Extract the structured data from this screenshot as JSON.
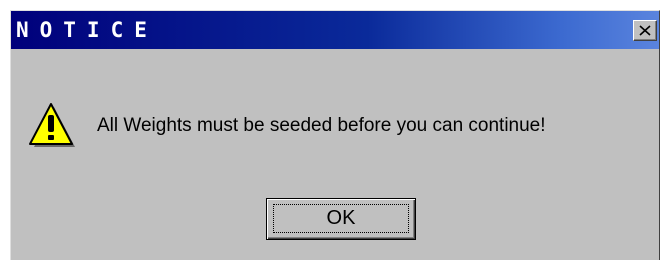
{
  "window": {
    "title": "NOTICE",
    "close_icon": "close-icon",
    "titlebar_color": "#00007b"
  },
  "content": {
    "icon": "warning-icon",
    "message": "All Weights must be seeded before you can continue!"
  },
  "buttons": {
    "ok_label": "OK"
  }
}
